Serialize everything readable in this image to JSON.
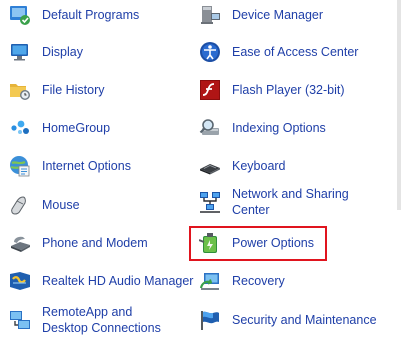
{
  "control_panel": {
    "items": [
      {
        "label": "Default Programs",
        "icon": "default-programs-icon"
      },
      {
        "label": "Device Manager",
        "icon": "device-manager-icon"
      },
      {
        "label": "Display",
        "icon": "display-icon"
      },
      {
        "label": "Ease of Access Center",
        "icon": "ease-of-access-icon"
      },
      {
        "label": "File History",
        "icon": "file-history-icon"
      },
      {
        "label": "Flash Player (32-bit)",
        "icon": "flash-player-icon"
      },
      {
        "label": "HomeGroup",
        "icon": "homegroup-icon"
      },
      {
        "label": "Indexing Options",
        "icon": "indexing-options-icon"
      },
      {
        "label": "Internet Options",
        "icon": "internet-options-icon"
      },
      {
        "label": "Keyboard",
        "icon": "keyboard-icon"
      },
      {
        "label": "Mouse",
        "icon": "mouse-icon"
      },
      {
        "label": "Network and Sharing Center",
        "icon": "network-sharing-icon"
      },
      {
        "label": "Phone and Modem",
        "icon": "phone-modem-icon"
      },
      {
        "label": "Power Options",
        "icon": "power-options-icon"
      },
      {
        "label": "Realtek HD Audio Manager",
        "icon": "realtek-audio-icon"
      },
      {
        "label": "Recovery",
        "icon": "recovery-icon"
      },
      {
        "label": "RemoteApp and Desktop Connections",
        "icon": "remoteapp-icon"
      },
      {
        "label": "Security and Maintenance",
        "icon": "security-maintenance-icon"
      }
    ],
    "highlighted_item": "Power Options",
    "highlight_color": "#e0141e",
    "link_color": "#1f3fa8"
  }
}
